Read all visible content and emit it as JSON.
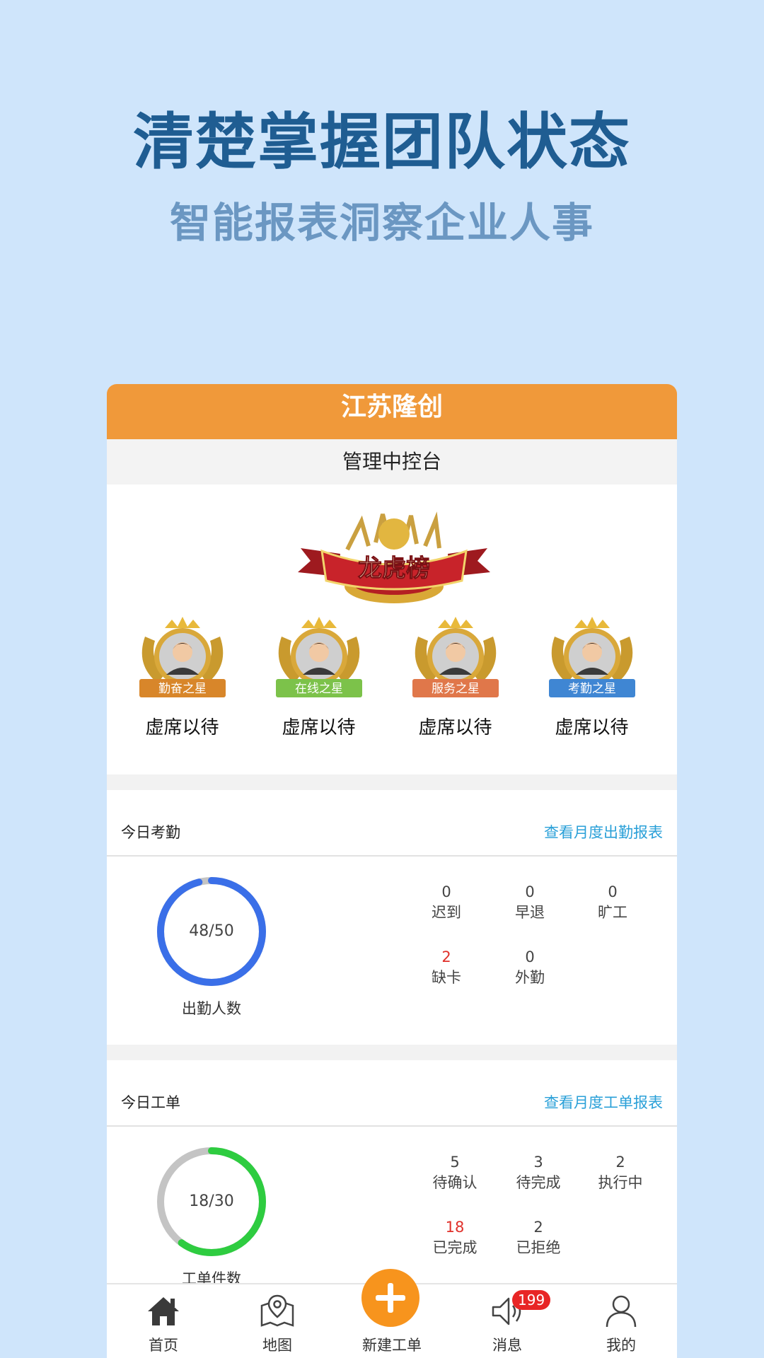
{
  "promo": {
    "headline": "清楚掌握团队状态",
    "subline": "智能报表洞察企业人事"
  },
  "app": {
    "company": "江苏隆创",
    "console": "管理中控台"
  },
  "ranking": {
    "banner_text": "龙虎榜",
    "stars": [
      {
        "badge": "勤奋之星",
        "name": "虚席以待",
        "color": "#d8862a"
      },
      {
        "badge": "在线之星",
        "name": "虚席以待",
        "color": "#7cc24a"
      },
      {
        "badge": "服务之星",
        "name": "虚席以待",
        "color": "#e0774a"
      },
      {
        "badge": "考勤之星",
        "name": "虚席以待",
        "color": "#3f86d3"
      }
    ]
  },
  "attendance": {
    "title": "今日考勤",
    "link": "查看月度出勤报表",
    "ring_text": "48/50",
    "ring_label": "出勤人数",
    "progress": 0.96,
    "ring_color": "#3a6fe8",
    "stats": [
      {
        "value": "0",
        "label": "迟到"
      },
      {
        "value": "0",
        "label": "早退"
      },
      {
        "value": "0",
        "label": "旷工"
      },
      {
        "value": "2",
        "label": "缺卡",
        "highlight": true
      },
      {
        "value": "0",
        "label": "外勤"
      }
    ]
  },
  "workorders": {
    "title": "今日工单",
    "link": "查看月度工单报表",
    "ring_text": "18/30",
    "ring_label": "工单件数",
    "progress": 0.6,
    "ring_color": "#2ecc40",
    "stats": [
      {
        "value": "5",
        "label": "待确认"
      },
      {
        "value": "3",
        "label": "待完成"
      },
      {
        "value": "2",
        "label": "执行中"
      },
      {
        "value": "18",
        "label": "已完成",
        "highlight": true
      },
      {
        "value": "2",
        "label": "已拒绝"
      }
    ]
  },
  "tabbar": {
    "items": [
      {
        "label": "首页",
        "icon": "home-icon"
      },
      {
        "label": "地图",
        "icon": "map-icon"
      },
      {
        "label": "新建工单",
        "icon": "plus-icon"
      },
      {
        "label": "消息",
        "icon": "speaker-icon",
        "badge": "199"
      },
      {
        "label": "我的",
        "icon": "user-icon"
      }
    ]
  },
  "colors": {
    "background": "#cfe5fb",
    "header": "#f0993a",
    "link": "#2aa0d8",
    "highlight": "#e0302a"
  }
}
